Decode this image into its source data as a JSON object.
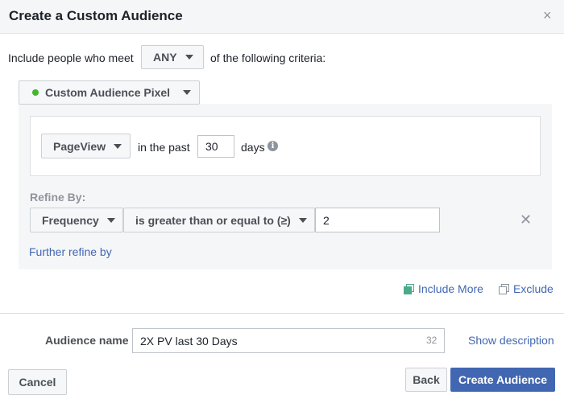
{
  "dialog": {
    "title": "Create a Custom Audience",
    "close_symbol": "×"
  },
  "criteria": {
    "prefix": "Include people who meet",
    "match_value": "ANY",
    "suffix": "of the following criteria:"
  },
  "source": {
    "label": "Custom Audience Pixel",
    "status_color": "#42b72a"
  },
  "rule": {
    "event": "PageView",
    "in_the_past": "in the past",
    "days_value": "30",
    "days_label": "days",
    "info_symbol": "i"
  },
  "refine": {
    "label": "Refine By:",
    "field": "Frequency",
    "operator": "is greater than or equal to (≥)",
    "value": "2",
    "remove_symbol": "✕",
    "further_link": "Further refine by"
  },
  "actions": {
    "include_more": "Include More",
    "exclude": "Exclude"
  },
  "audience_name": {
    "label": "Audience name",
    "value": "2X PV last 30 Days",
    "char_count": "32",
    "show_description": "Show description"
  },
  "footer": {
    "cancel": "Cancel",
    "back": "Back",
    "create": "Create Audience"
  },
  "colors": {
    "primary": "#4267b2",
    "link": "#4267b2",
    "panel": "#f5f6f7"
  }
}
